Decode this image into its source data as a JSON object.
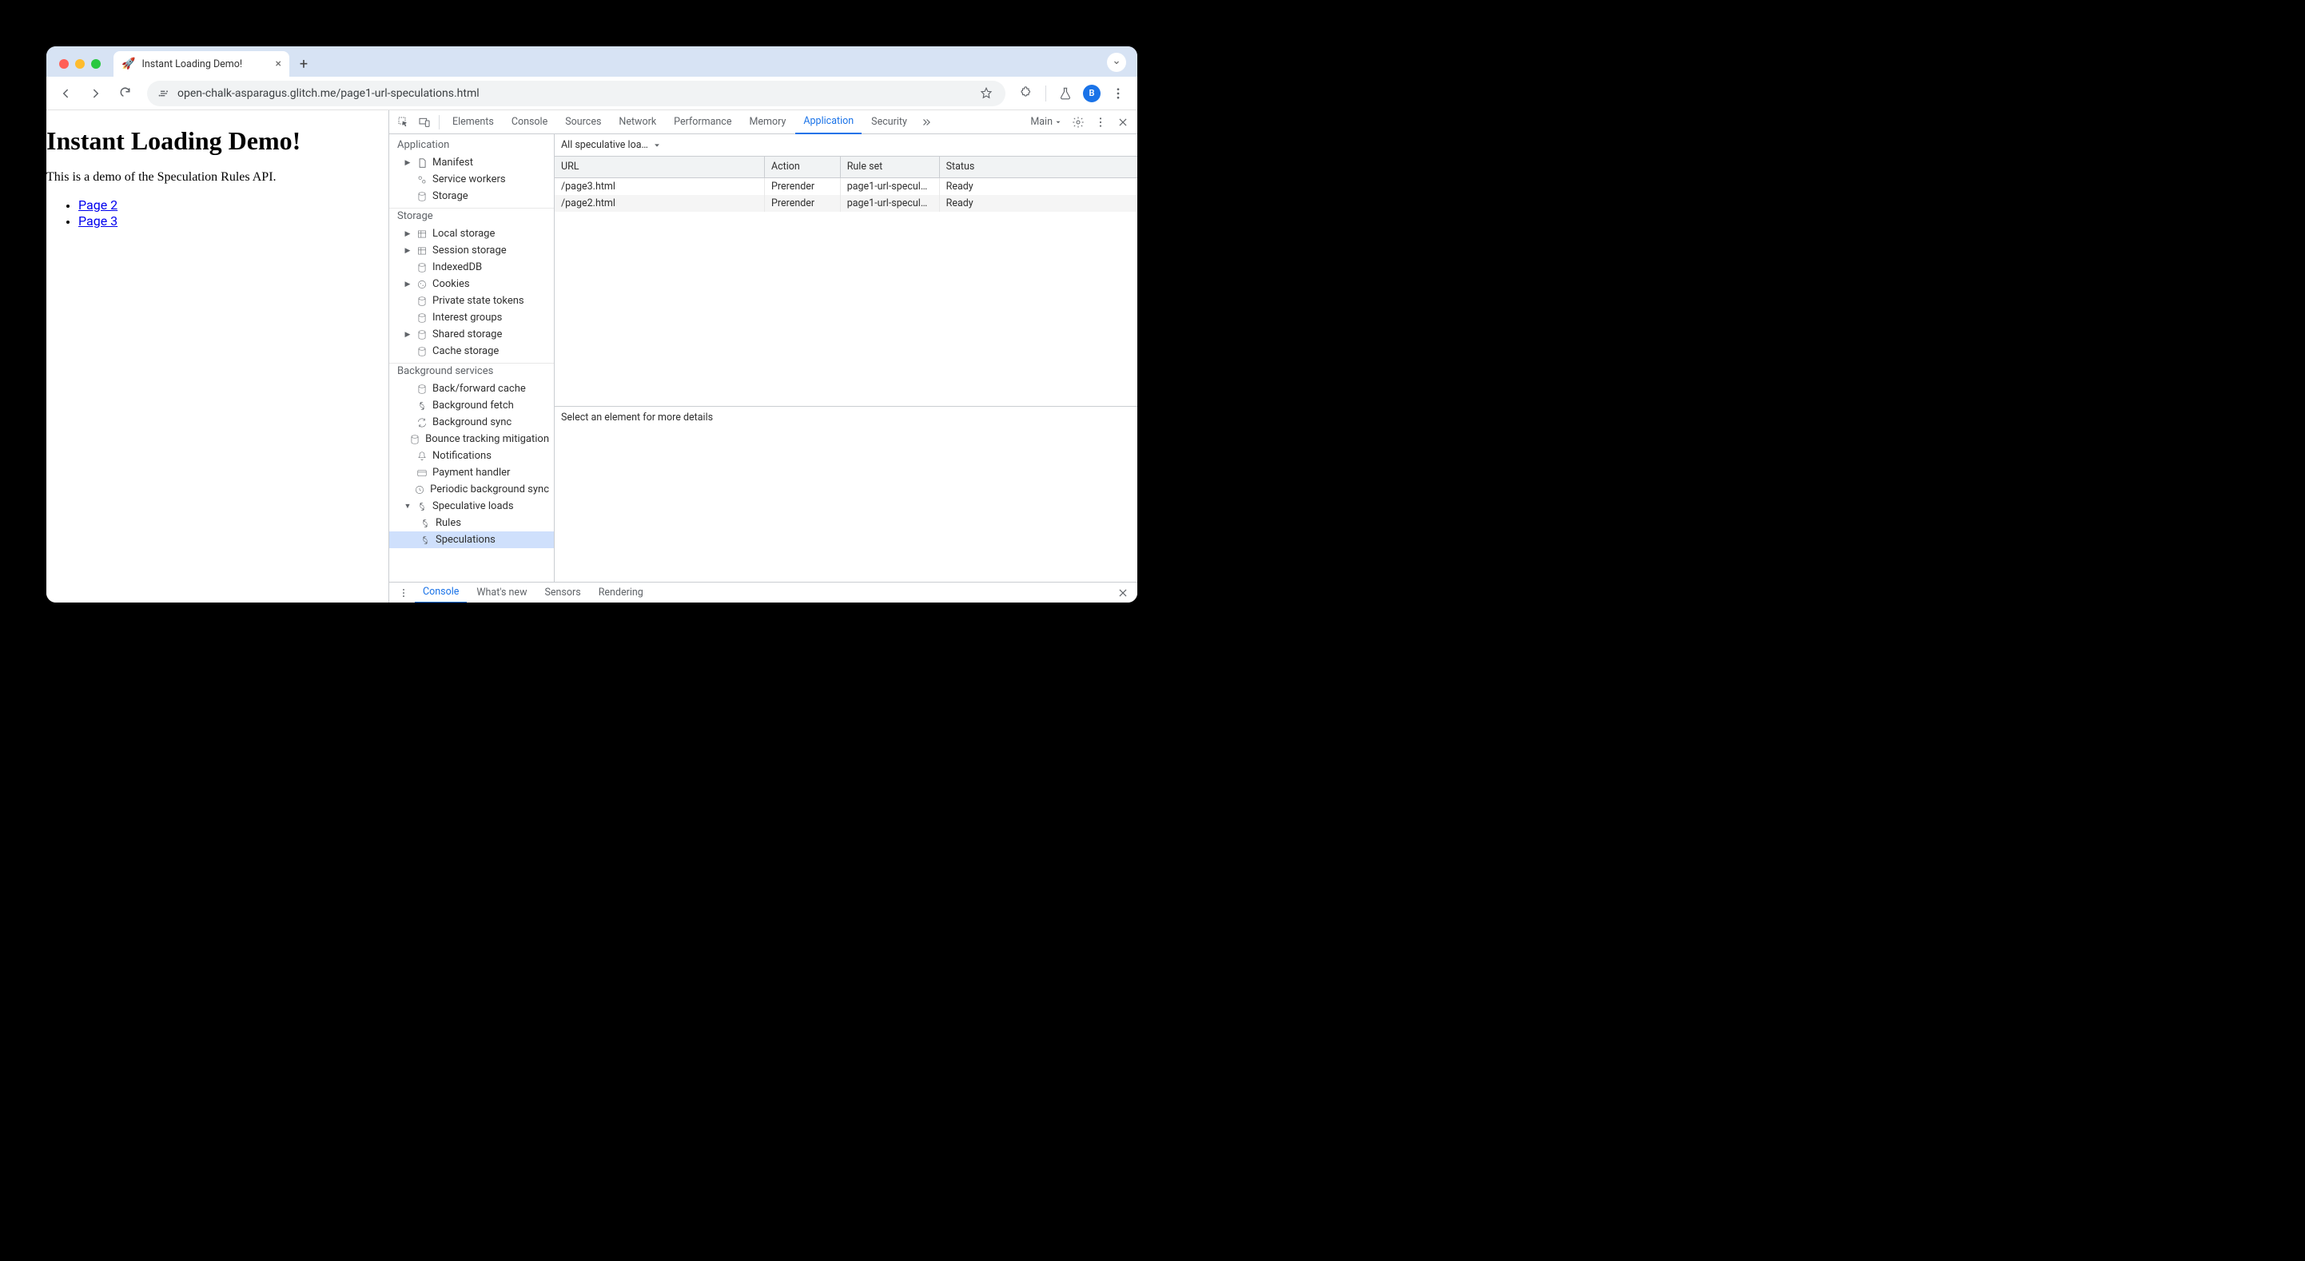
{
  "browser": {
    "tab": {
      "favicon": "🚀",
      "title": "Instant Loading Demo!"
    },
    "url": "open-chalk-asparagus.glitch.me/page1-url-speculations.html",
    "avatar_letter": "B"
  },
  "page": {
    "heading": "Instant Loading Demo!",
    "blurb": "This is a demo of the Speculation Rules API.",
    "links": [
      "Page 2",
      "Page 3"
    ]
  },
  "devtools": {
    "tabs": [
      "Elements",
      "Console",
      "Sources",
      "Network",
      "Performance",
      "Memory",
      "Application",
      "Security"
    ],
    "active_tab": "Application",
    "target_label": "Main",
    "sidebar": {
      "application": {
        "title": "Application",
        "items": [
          "Manifest",
          "Service workers",
          "Storage"
        ]
      },
      "storage": {
        "title": "Storage",
        "items": [
          "Local storage",
          "Session storage",
          "IndexedDB",
          "Cookies",
          "Private state tokens",
          "Interest groups",
          "Shared storage",
          "Cache storage"
        ]
      },
      "background": {
        "title": "Background services",
        "items": [
          "Back/forward cache",
          "Background fetch",
          "Background sync",
          "Bounce tracking mitigation",
          "Notifications",
          "Payment handler",
          "Periodic background sync",
          "Speculative loads"
        ],
        "speculative_children": [
          "Rules",
          "Speculations"
        ],
        "selected": "Speculations"
      }
    },
    "filter": "All speculative loa…",
    "table": {
      "headers": [
        "URL",
        "Action",
        "Rule set",
        "Status"
      ],
      "rows": [
        {
          "url": "/page3.html",
          "action": "Prerender",
          "ruleset": "page1-url-specul…",
          "status": "Ready"
        },
        {
          "url": "/page2.html",
          "action": "Prerender",
          "ruleset": "page1-url-specul…",
          "status": "Ready"
        }
      ]
    },
    "details_placeholder": "Select an element for more details",
    "drawer": {
      "tabs": [
        "Console",
        "What's new",
        "Sensors",
        "Rendering"
      ],
      "active": "Console"
    }
  }
}
